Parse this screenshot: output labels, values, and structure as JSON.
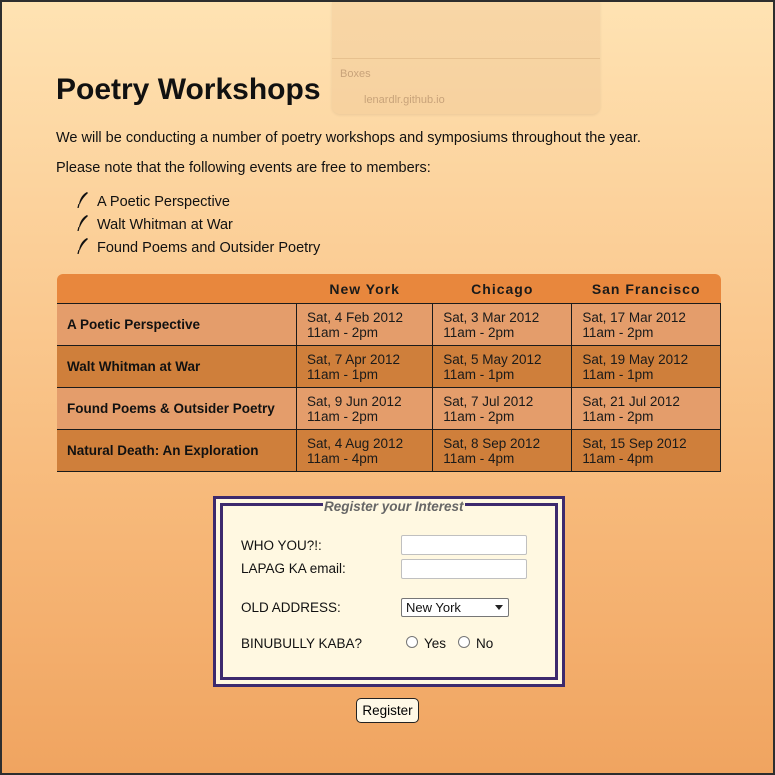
{
  "ghost": {
    "line1": "Boxes",
    "line2": "lenardlr.github.io"
  },
  "heading": "Poetry Workshops",
  "intro": "We will be conducting a number of poetry workshops and symposiums throughout the year.",
  "note": "Please note that the following events are free to members:",
  "free_events": [
    "A Poetic Perspective",
    "Walt Whitman at War",
    "Found Poems and Outsider Poetry"
  ],
  "icon": "quill-icon",
  "schedule": {
    "headers": [
      "",
      "New York",
      "Chicago",
      "San Francisco"
    ],
    "rows": [
      {
        "event": "A Poetic Perspective",
        "dates": [
          [
            "Sat, 4 Feb 2012",
            "11am - 2pm"
          ],
          [
            "Sat, 3 Mar 2012",
            "11am - 2pm"
          ],
          [
            "Sat, 17 Mar 2012",
            "11am - 2pm"
          ]
        ]
      },
      {
        "event": "Walt Whitman at War",
        "dates": [
          [
            "Sat, 7 Apr 2012",
            "11am - 1pm"
          ],
          [
            "Sat, 5 May 2012",
            "11am - 1pm"
          ],
          [
            "Sat, 19 May 2012",
            "11am - 1pm"
          ]
        ]
      },
      {
        "event": "Found Poems & Outsider Poetry",
        "dates": [
          [
            "Sat, 9 Jun 2012",
            "11am - 2pm"
          ],
          [
            "Sat, 7 Jul 2012",
            "11am - 2pm"
          ],
          [
            "Sat, 21 Jul 2012",
            "11am - 2pm"
          ]
        ]
      },
      {
        "event": "Natural Death: An Exploration",
        "dates": [
          [
            "Sat, 4 Aug 2012",
            "11am - 4pm"
          ],
          [
            "Sat, 8 Sep 2012",
            "11am - 4pm"
          ],
          [
            "Sat, 15 Sep 2012",
            "11am - 4pm"
          ]
        ]
      }
    ]
  },
  "form": {
    "legend": "Register your Interest",
    "name_label": "WHO YOU?!:",
    "name_value": "",
    "email_label": "LAPAG KA email:",
    "email_value": "",
    "address_label": "OLD ADDRESS:",
    "address_selected": "New York",
    "bullied_label": "BINUBULLY KABA?",
    "yes_label": "Yes",
    "no_label": "No"
  },
  "register_button": "Register",
  "colors": {
    "header": "#e8873d",
    "row_light": "#e49d6b",
    "row_dark": "#cf7f3b",
    "form_border": "#3d2a6d",
    "form_bg": "#fff8e1"
  }
}
